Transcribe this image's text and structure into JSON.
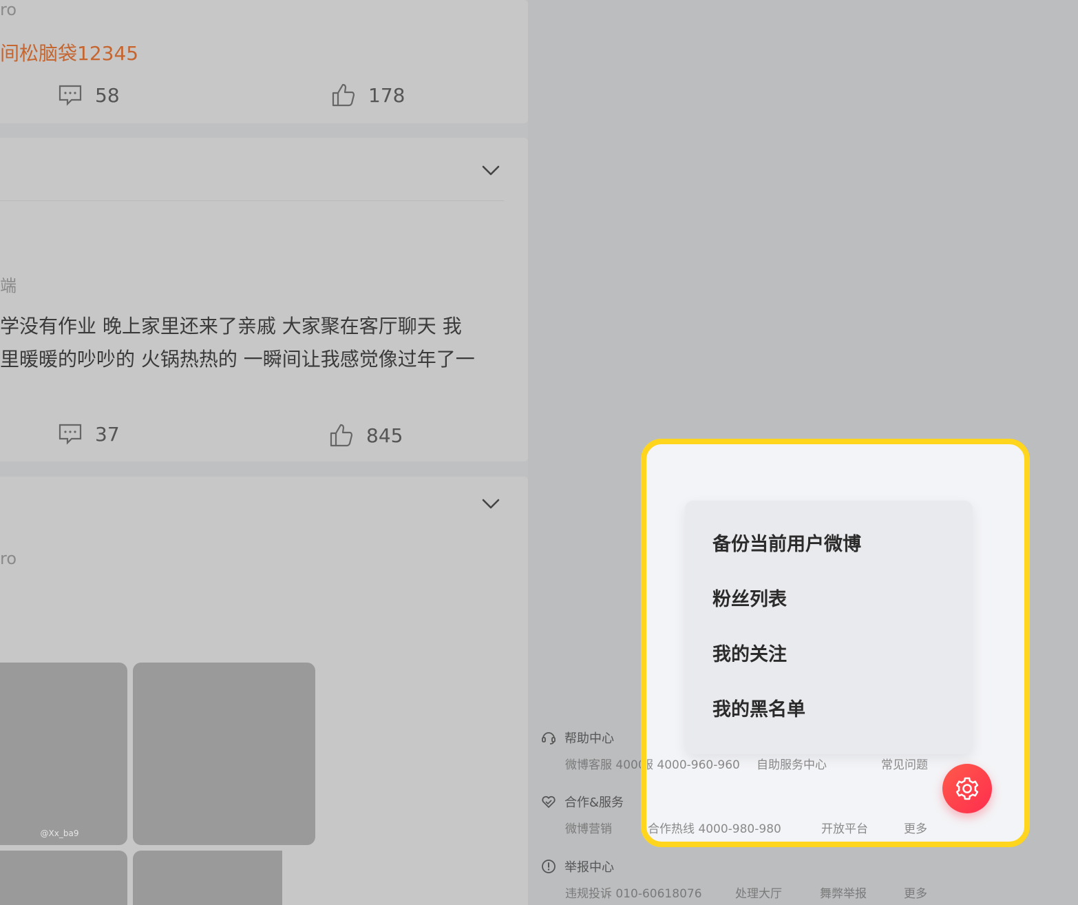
{
  "feed": {
    "post1": {
      "source_fragment": "ro",
      "mention": "间松脑袋12345",
      "comments": "58",
      "likes": "178"
    },
    "post2": {
      "source_fragment": "端",
      "text_line1": "学没有作业 晚上家里还来了亲戚 大家聚在客厅聊天 我",
      "text_line2": "里暖暖的吵吵的 火锅热热的 一瞬间让我感觉像过年了一",
      "comments": "37",
      "likes": "845"
    },
    "post3": {
      "source_fragment": "ro",
      "photo_watermark": "@Xx_ba9"
    }
  },
  "footer": {
    "help": {
      "title": "帮助中心",
      "links": [
        "微博客服 4000-960-960",
        "自助服务中心",
        "常见问题"
      ]
    },
    "coop": {
      "title": "合作&服务",
      "links": [
        "微博营销",
        "合作热线 4000-980-980",
        "开放平台",
        "更多"
      ]
    },
    "report": {
      "title": "举报中心",
      "links": [
        "违规投诉 010-60618076",
        "处理大厅",
        "舞弊举报",
        "更多"
      ]
    }
  },
  "menu": {
    "items": [
      {
        "label": "备份当前用户微博"
      },
      {
        "label": "粉丝列表"
      },
      {
        "label": "我的关注"
      },
      {
        "label": "我的黑名单"
      }
    ]
  },
  "colors": {
    "highlight_border": "#ffd51e",
    "mention": "#c5652f",
    "gear_gradient_start": "#ff5a4a",
    "gear_gradient_end": "#ff2d4e"
  },
  "icons": {
    "comment": "comment-icon",
    "like": "thumbs-up-icon",
    "expand": "chevron-down-icon",
    "settings": "gear-icon",
    "help": "headset-icon",
    "coop": "handshake-heart-icon",
    "report": "exclamation-circle-icon"
  }
}
